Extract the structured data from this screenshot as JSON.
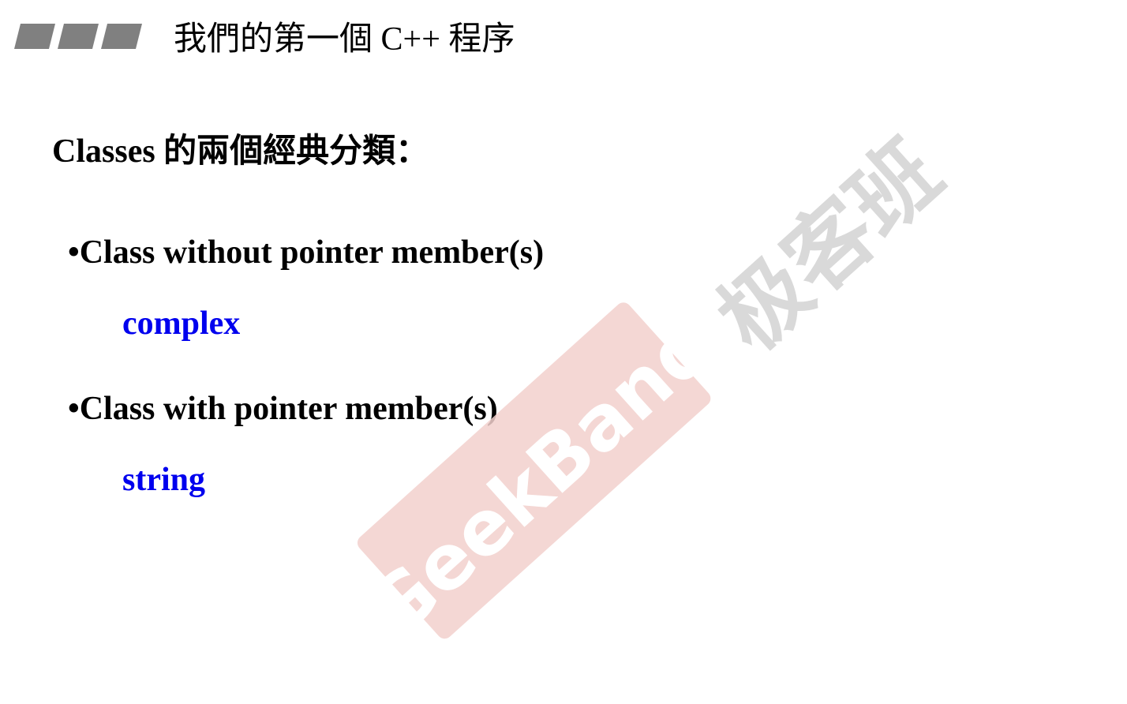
{
  "header": {
    "title": "我們的第一個 C++ 程序"
  },
  "content": {
    "heading": "Classes 的兩個經典分類：",
    "bullets": [
      {
        "label": "•Class without pointer member(s)",
        "example": "complex"
      },
      {
        "label": "•Class with pointer member(s)",
        "example": "string"
      }
    ]
  },
  "watermark": {
    "brand_en": "GeekBand",
    "brand_cn": "极客班"
  },
  "colors": {
    "text": "#000000",
    "example_text": "#0000ee",
    "header_bars": "#808080",
    "watermark_bg": "#f2d0cc",
    "watermark_text_en": "#ffffff",
    "watermark_text_cn": "#d9d9d9"
  }
}
